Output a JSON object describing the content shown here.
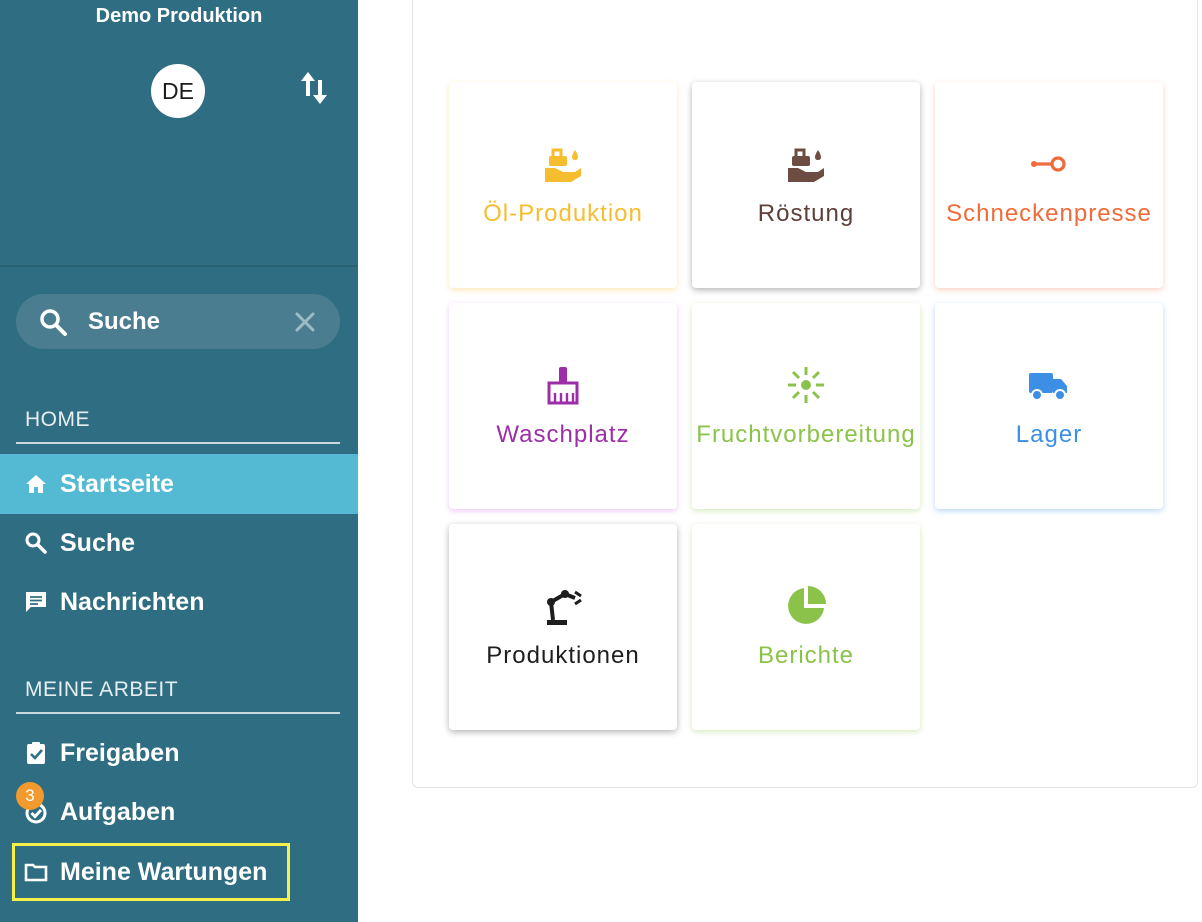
{
  "sidebar": {
    "org_name": "Demo Produktion",
    "avatar_initials": "DE",
    "search": {
      "value": "Suche"
    },
    "sections": {
      "home": "HOME",
      "my_work": "MEINE ARBEIT"
    },
    "nav": [
      {
        "label": "Startseite",
        "icon": "home-icon",
        "active": true
      },
      {
        "label": "Suche",
        "icon": "search-icon"
      },
      {
        "label": "Nachrichten",
        "icon": "message-icon"
      },
      {
        "label": "Freigaben",
        "icon": "clipboard-check-icon"
      },
      {
        "label": "Aufgaben",
        "icon": "check-circle-icon",
        "badge": "3"
      },
      {
        "label": "Meine Wartungen",
        "icon": "folder-icon",
        "highlighted": true
      }
    ]
  },
  "tiles": [
    {
      "label": "Öl-Produktion",
      "icon": "oil-hand-icon",
      "color": "#f6bd2f"
    },
    {
      "label": "Röstung",
      "icon": "oil-hand-icon",
      "color": "#6d4c41"
    },
    {
      "label": "Schneckenpresse",
      "icon": "key-icon",
      "color": "#ee6b3b"
    },
    {
      "label": "Waschplatz",
      "icon": "broom-icon",
      "color": "#9c2ea8"
    },
    {
      "label": "Fruchtvorbereitung",
      "icon": "sparkle-icon",
      "color": "#8bc34a"
    },
    {
      "label": "Lager",
      "icon": "truck-icon",
      "color": "#3d8fe6"
    },
    {
      "label": "Produktionen",
      "icon": "robot-arm-icon",
      "color": "#1e1e1e"
    },
    {
      "label": "Berichte",
      "icon": "pie-chart-icon",
      "color": "#8bc34a"
    }
  ]
}
